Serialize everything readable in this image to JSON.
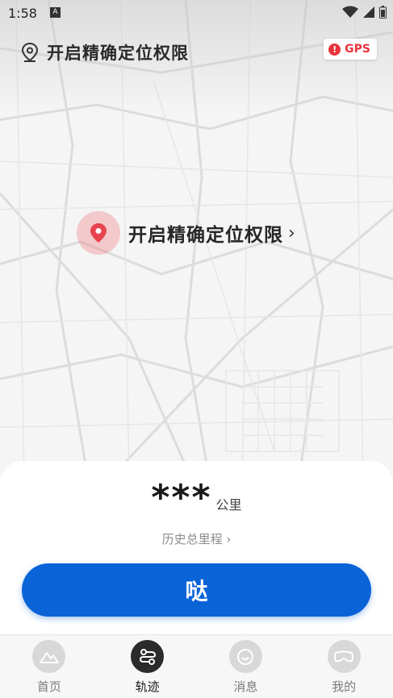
{
  "status_bar": {
    "time": "1:58",
    "app_icon": "A"
  },
  "header": {
    "title": "开启精确定位权限",
    "gps_badge": "GPS"
  },
  "map_prompt": {
    "label": "开启精确定位权限",
    "chevron": "›"
  },
  "summary": {
    "distance": "***",
    "unit": "公里",
    "history_link": "历史总里程 ›"
  },
  "primary_button": {
    "label": "哒"
  },
  "tabs": [
    {
      "label": "首页",
      "icon": "mountain-icon"
    },
    {
      "label": "轨迹",
      "icon": "route-icon"
    },
    {
      "label": "消息",
      "icon": "chat-icon"
    },
    {
      "label": "我的",
      "icon": "goggles-icon"
    }
  ],
  "colors": {
    "primary": "#0b63d8",
    "alert": "#e8333c",
    "pin": "#e8434f"
  }
}
